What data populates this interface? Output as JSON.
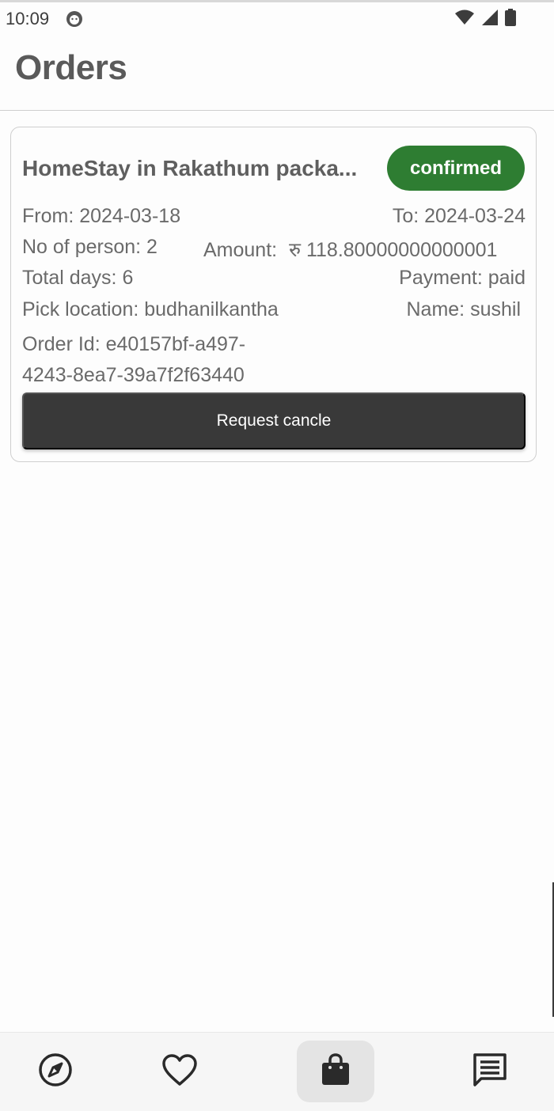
{
  "status_bar": {
    "time": "10:09"
  },
  "app_bar": {
    "title": "Orders"
  },
  "order": {
    "title": "HomeStay in Rakathum packa...",
    "status": "confirmed",
    "status_color": "#2e7d32",
    "from": "From: 2024-03-18",
    "to": "To: 2024-03-24",
    "persons": "No of person: 2",
    "amount_label": "Amount:",
    "amount_value": "रु 118.80000000000001",
    "total_days": "Total days: 6",
    "payment": "Payment: paid",
    "pick_location": "Pick location: budhanilkantha",
    "name": "Name: sushil",
    "order_id": "Order Id: e40157bf-a497-4243-8ea7-39a7f2f63440",
    "cancel_label": "Request cancle"
  },
  "bottom_nav": {
    "items": [
      {
        "icon": "compass-icon",
        "active": false
      },
      {
        "icon": "heart-icon",
        "active": false
      },
      {
        "icon": "shopping-bag-icon",
        "active": true
      },
      {
        "icon": "chat-icon",
        "active": false
      }
    ]
  },
  "colors": {
    "button_dark": "#393939",
    "badge_green": "#2e7d32"
  }
}
